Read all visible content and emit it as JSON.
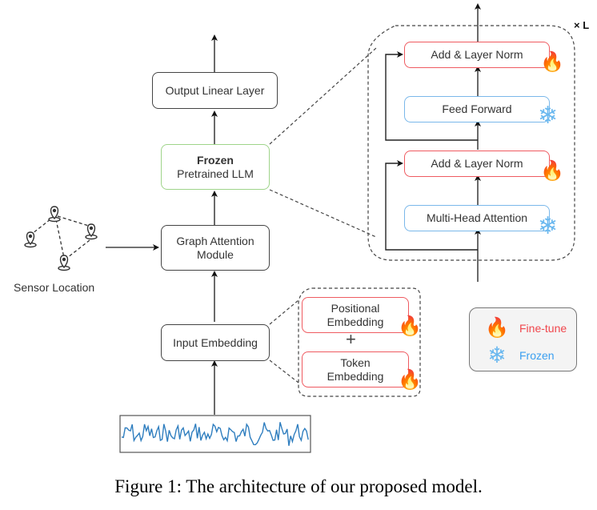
{
  "caption": "Figure 1: The architecture of our proposed model.",
  "main_pipeline": {
    "output_linear": "Output Linear Layer",
    "llm_bold": "Frozen",
    "llm_label": "Pretrained LLM",
    "graph_attention_line1": "Graph Attention",
    "graph_attention_line2": "Module",
    "input_embedding": "Input Embedding"
  },
  "sensor": {
    "label": "Sensor Location",
    "icon": "map-pin-icon"
  },
  "embedding_detail": {
    "positional_line1": "Positional",
    "positional_line2": "Embedding",
    "plus": "+",
    "token_line1": "Token",
    "token_line2": "Embedding"
  },
  "transformer_block": {
    "repeat": "× L",
    "add_norm_top": "Add & Layer Norm",
    "feed_forward": "Feed Forward",
    "add_norm_bottom": "Add & Layer Norm",
    "multi_head_attention": "Multi-Head Attention"
  },
  "legend": {
    "items": [
      {
        "icon": "fire-icon",
        "glyph": "🔥",
        "label": "Fine-tune",
        "color": "#f0464c"
      },
      {
        "icon": "snowflake-icon",
        "glyph": "❄",
        "label": "Frozen",
        "color": "#3a9ff0"
      }
    ]
  },
  "glyphs": {
    "fire": "🔥",
    "snow": "❄"
  },
  "colors": {
    "fine_tune": "#ef5b61",
    "frozen": "#7ab8ea",
    "llm": "#9fd48a",
    "signal": "#2f7ebf"
  }
}
